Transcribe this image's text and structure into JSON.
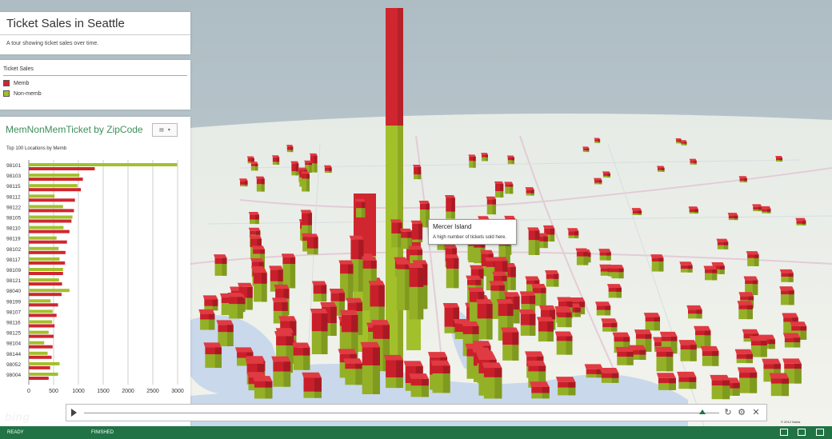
{
  "tour": {
    "title": "Ticket Sales in Seattle",
    "description": "A tour showing ticket sales over time."
  },
  "legend": {
    "title": "Ticket Sales",
    "items": [
      {
        "label": "Memb",
        "color": "#d0262f"
      },
      {
        "label": "Non-memb",
        "color": "#a2c02a"
      }
    ]
  },
  "chart": {
    "title": "MemNonMemTicket by ZipCode",
    "subtitle": "Top 100 Locations by Memb"
  },
  "chart_data": {
    "type": "bar",
    "orientation": "horizontal",
    "title": "MemNonMemTicket by ZipCode",
    "subtitle": "Top 100 Locations by Memb",
    "categories": [
      "98101",
      "98103",
      "98115",
      "98112",
      "98122",
      "98105",
      "98110",
      "98119",
      "98102",
      "98117",
      "98109",
      "98121",
      "98040",
      "98199",
      "98107",
      "98116",
      "98125",
      "98104",
      "98144",
      "98052",
      "98004"
    ],
    "series": [
      {
        "name": "Memb",
        "color": "#d0262f",
        "values": [
          1330,
          1090,
          1050,
          930,
          910,
          860,
          820,
          770,
          740,
          730,
          690,
          670,
          660,
          590,
          560,
          520,
          500,
          480,
          460,
          430,
          400
        ]
      },
      {
        "name": "Non-memb",
        "color": "#a2c02a",
        "values": [
          2990,
          1020,
          980,
          520,
          690,
          880,
          700,
          560,
          600,
          620,
          690,
          610,
          820,
          440,
          480,
          470,
          400,
          310,
          380,
          620,
          590
        ]
      }
    ],
    "xticks": [
      0,
      500,
      1000,
      1500,
      2000,
      2500,
      3000
    ],
    "xlim": [
      0,
      3000
    ],
    "grid": true
  },
  "tooltip": {
    "title": "Mercer Island",
    "text": "A high number of tickets sold here."
  },
  "map": {
    "logo": "bing",
    "copyright": "© 2012 Nokia"
  },
  "playback": {
    "progress": 0.997,
    "icons": [
      "play-icon",
      "refresh-icon",
      "gear-icon",
      "close-icon"
    ]
  },
  "status": {
    "ready": "READY",
    "finished": "FINISHED",
    "accent": "#217346"
  }
}
